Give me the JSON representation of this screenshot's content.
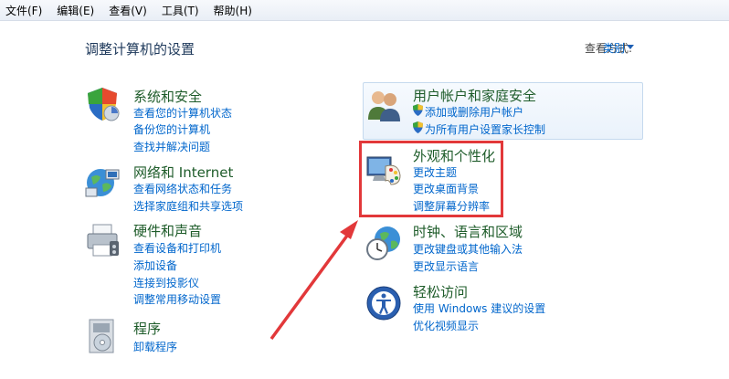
{
  "menubar": {
    "items": [
      "文件(F)",
      "编辑(E)",
      "查看(V)",
      "工具(T)",
      "帮助(H)"
    ]
  },
  "header": {
    "title": "调整计算机的设置",
    "view_by_label": "查看方式:",
    "view_by_value": "类别"
  },
  "categories": {
    "system": {
      "icon": "shield-icon",
      "title": "系统和安全",
      "links": [
        "查看您的计算机状态",
        "备份您的计算机",
        "查找并解决问题"
      ]
    },
    "network": {
      "icon": "network-globe-icon",
      "title": "网络和 Internet",
      "links": [
        "查看网络状态和任务",
        "选择家庭组和共享选项"
      ]
    },
    "hardware": {
      "icon": "printer-icon",
      "title": "硬件和声音",
      "links": [
        "查看设备和打印机",
        "添加设备",
        "连接到投影仪",
        "调整常用移动设置"
      ]
    },
    "programs": {
      "icon": "programs-disc-icon",
      "title": "程序",
      "links": [
        "卸载程序"
      ]
    },
    "users": {
      "icon": "users-icon",
      "title": "用户帐户和家庭安全",
      "links": [
        "添加或删除用户帐户",
        "为所有用户设置家长控制"
      ]
    },
    "appearance": {
      "icon": "monitor-palette-icon",
      "title": "外观和个性化",
      "links": [
        "更改主题",
        "更改桌面背景",
        "调整屏幕分辨率"
      ]
    },
    "clock": {
      "icon": "clock-globe-icon",
      "title": "时钟、语言和区域",
      "links": [
        "更改键盘或其他输入法",
        "更改显示语言"
      ]
    },
    "ease": {
      "icon": "accessibility-icon",
      "title": "轻松访问",
      "links": [
        "使用 Windows 建议的设置",
        "优化视频显示"
      ]
    }
  },
  "colors": {
    "link": "#0066cc",
    "category_title": "#1e5c2a",
    "annotation": "#e2383a"
  }
}
